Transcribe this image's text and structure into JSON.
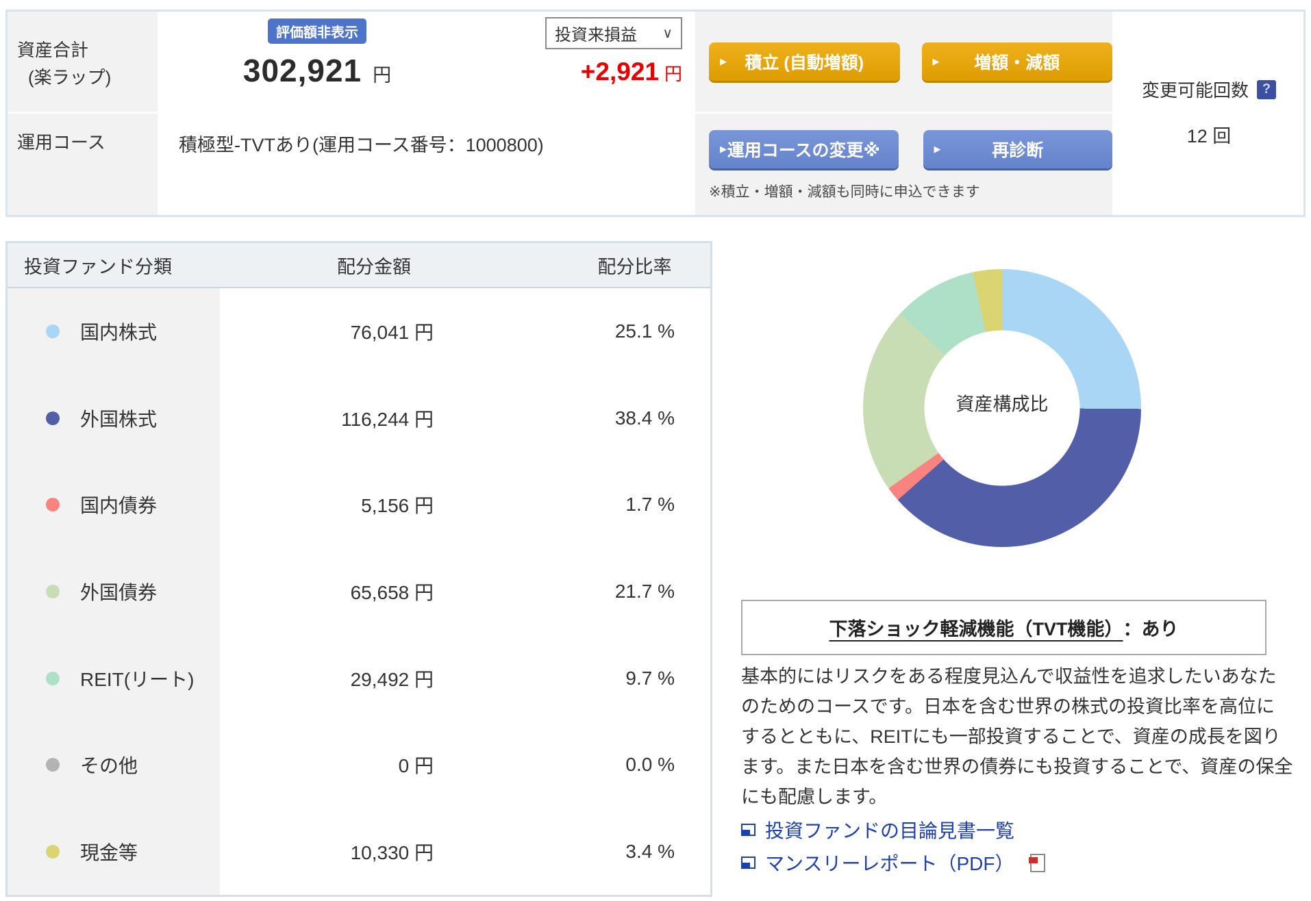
{
  "icons": {
    "arrow": "▶",
    "chevron_down": "∨",
    "help": "?"
  },
  "summary": {
    "asset_label_line1": "資産合計",
    "asset_label_line2": "(楽ラップ)",
    "hide_badge": "評価額非表示",
    "total_value": "302,921",
    "total_unit": "円",
    "pl_dropdown_value": "投資来損益",
    "pl_value": "+2,921",
    "pl_unit": "円",
    "btn_tsumitate": "積立 (自動増額)",
    "btn_zogaku": "増額・減額",
    "course_label": "運用コース",
    "course_value": "積極型-TVTあり(運用コース番号：1000800)",
    "btn_course_change": "運用コースの変更※",
    "btn_rediagnosis": "再診断",
    "note": "※積立・増額・減額も同時に申込できます",
    "change_count_label": "変更可能回数",
    "change_count_value": "12 回"
  },
  "allocation_table": {
    "headers": [
      "投資ファンド分類",
      "配分金額",
      "配分比率"
    ],
    "rows": [
      {
        "label": "国内株式",
        "amount": "76,041 円",
        "ratio": "25.1 %",
        "color": "#a9d6f5"
      },
      {
        "label": "外国株式",
        "amount": "116,244 円",
        "ratio": "38.4 %",
        "color": "#525fa8"
      },
      {
        "label": "国内債券",
        "amount": "5,156 円",
        "ratio": "1.7 %",
        "color": "#f8837f"
      },
      {
        "label": "外国債券",
        "amount": "65,658 円",
        "ratio": "21.7 %",
        "color": "#c9ddb5"
      },
      {
        "label": "REIT(リート)",
        "amount": "29,492 円",
        "ratio": "9.7 %",
        "color": "#aee0c8"
      },
      {
        "label": "その他",
        "amount": "0 円",
        "ratio": "0.0 %",
        "color": "#b3b3b3"
      },
      {
        "label": "現金等",
        "amount": "10,330 円",
        "ratio": "3.4 %",
        "color": "#dbd473"
      }
    ]
  },
  "chart_data": {
    "type": "pie",
    "donut": true,
    "title": "資産構成比",
    "center_label": "資産構成比",
    "categories": [
      "国内株式",
      "外国株式",
      "国内債券",
      "外国債券",
      "REIT(リート)",
      "その他",
      "現金等"
    ],
    "values": [
      25.1,
      38.4,
      1.7,
      21.7,
      9.7,
      0.0,
      3.4
    ],
    "amounts_yen": [
      76041,
      116244,
      5156,
      65658,
      29492,
      0,
      10330
    ],
    "colors": [
      "#a9d6f5",
      "#525fa8",
      "#f8837f",
      "#c9ddb5",
      "#aee0c8",
      "#b3b3b3",
      "#dbd473"
    ],
    "legend_position": "left-table",
    "start_angle_deg": 0,
    "direction": "clockwise"
  },
  "tvt_box": {
    "heading_underlined": "下落ショック軽減機能（TVT機能）",
    "heading_suffix": "：あり"
  },
  "course_description": "基本的にはリスクをある程度見込んで収益性を追求したいあなたのためのコースです。日本を含む世界の株式の投資比率を高位にするとともに、REITにも一部投資することで、資産の成長を図ります。また日本を含む世界の債券にも投資することで、資産の保全にも配慮します。",
  "links": [
    {
      "label": "投資ファンドの目論見書一覧"
    },
    {
      "label": "マンスリーレポート（PDF）"
    }
  ]
}
